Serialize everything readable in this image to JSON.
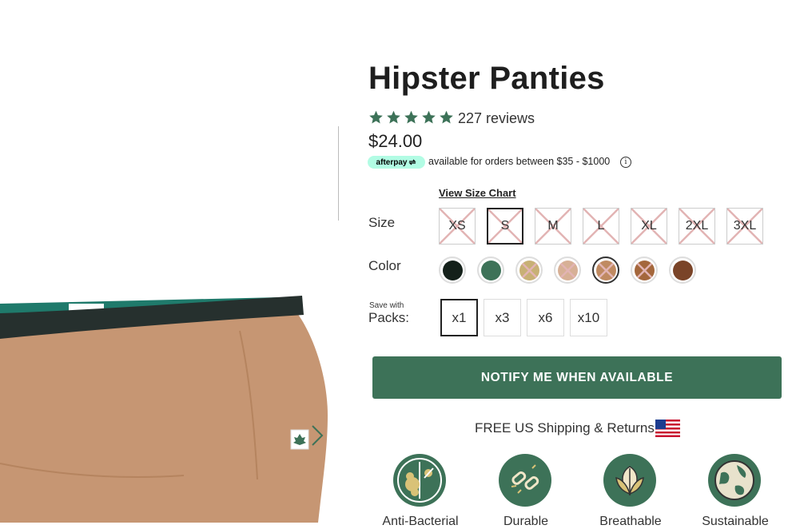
{
  "product": {
    "title": "Hipster Panties",
    "rating_stars": 5,
    "reviews": "227 reviews",
    "price": "$24.00",
    "afterpay_logo": "afterpay",
    "afterpay_text": "available for orders between $35 - $1000",
    "info_symbol": "i"
  },
  "size": {
    "label": "Size",
    "chart_link": "View Size Chart",
    "options": [
      "XS",
      "S",
      "M",
      "L",
      "XL",
      "2XL",
      "3XL"
    ],
    "selected": "S"
  },
  "color": {
    "label": "Color",
    "swatches": [
      {
        "name": "black",
        "hex": "#14201a",
        "available": true
      },
      {
        "name": "green",
        "hex": "#3d7258",
        "available": true
      },
      {
        "name": "khaki",
        "hex": "#c8b075",
        "available": false
      },
      {
        "name": "nude",
        "hex": "#d7b096",
        "available": false
      },
      {
        "name": "tan",
        "hex": "#c08a61",
        "available": false,
        "selected": true
      },
      {
        "name": "caramel",
        "hex": "#a4673c",
        "available": false
      },
      {
        "name": "brown",
        "hex": "#7a4428",
        "available": true
      }
    ]
  },
  "packs": {
    "small_label": "Save with",
    "label": "Packs:",
    "options": [
      "x1",
      "x3",
      "x6",
      "x10"
    ],
    "selected": "x1"
  },
  "cta": {
    "notify_label": "NOTIFY ME WHEN AVAILABLE"
  },
  "shipping": {
    "text": "FREE US Shipping & Returns",
    "flag_icon": "us-flag-icon"
  },
  "features": [
    {
      "label": "Anti-Bacterial",
      "icon": "bacteria-icon"
    },
    {
      "label": "Durable",
      "icon": "chain-link-icon"
    },
    {
      "label": "Breathable",
      "icon": "leaf-icon"
    },
    {
      "label": "Sustainable",
      "icon": "earth-icon"
    }
  ],
  "colors": {
    "brand_green": "#3d7258",
    "star": "#3d7258",
    "afterpay_mint": "#b2fce4"
  }
}
